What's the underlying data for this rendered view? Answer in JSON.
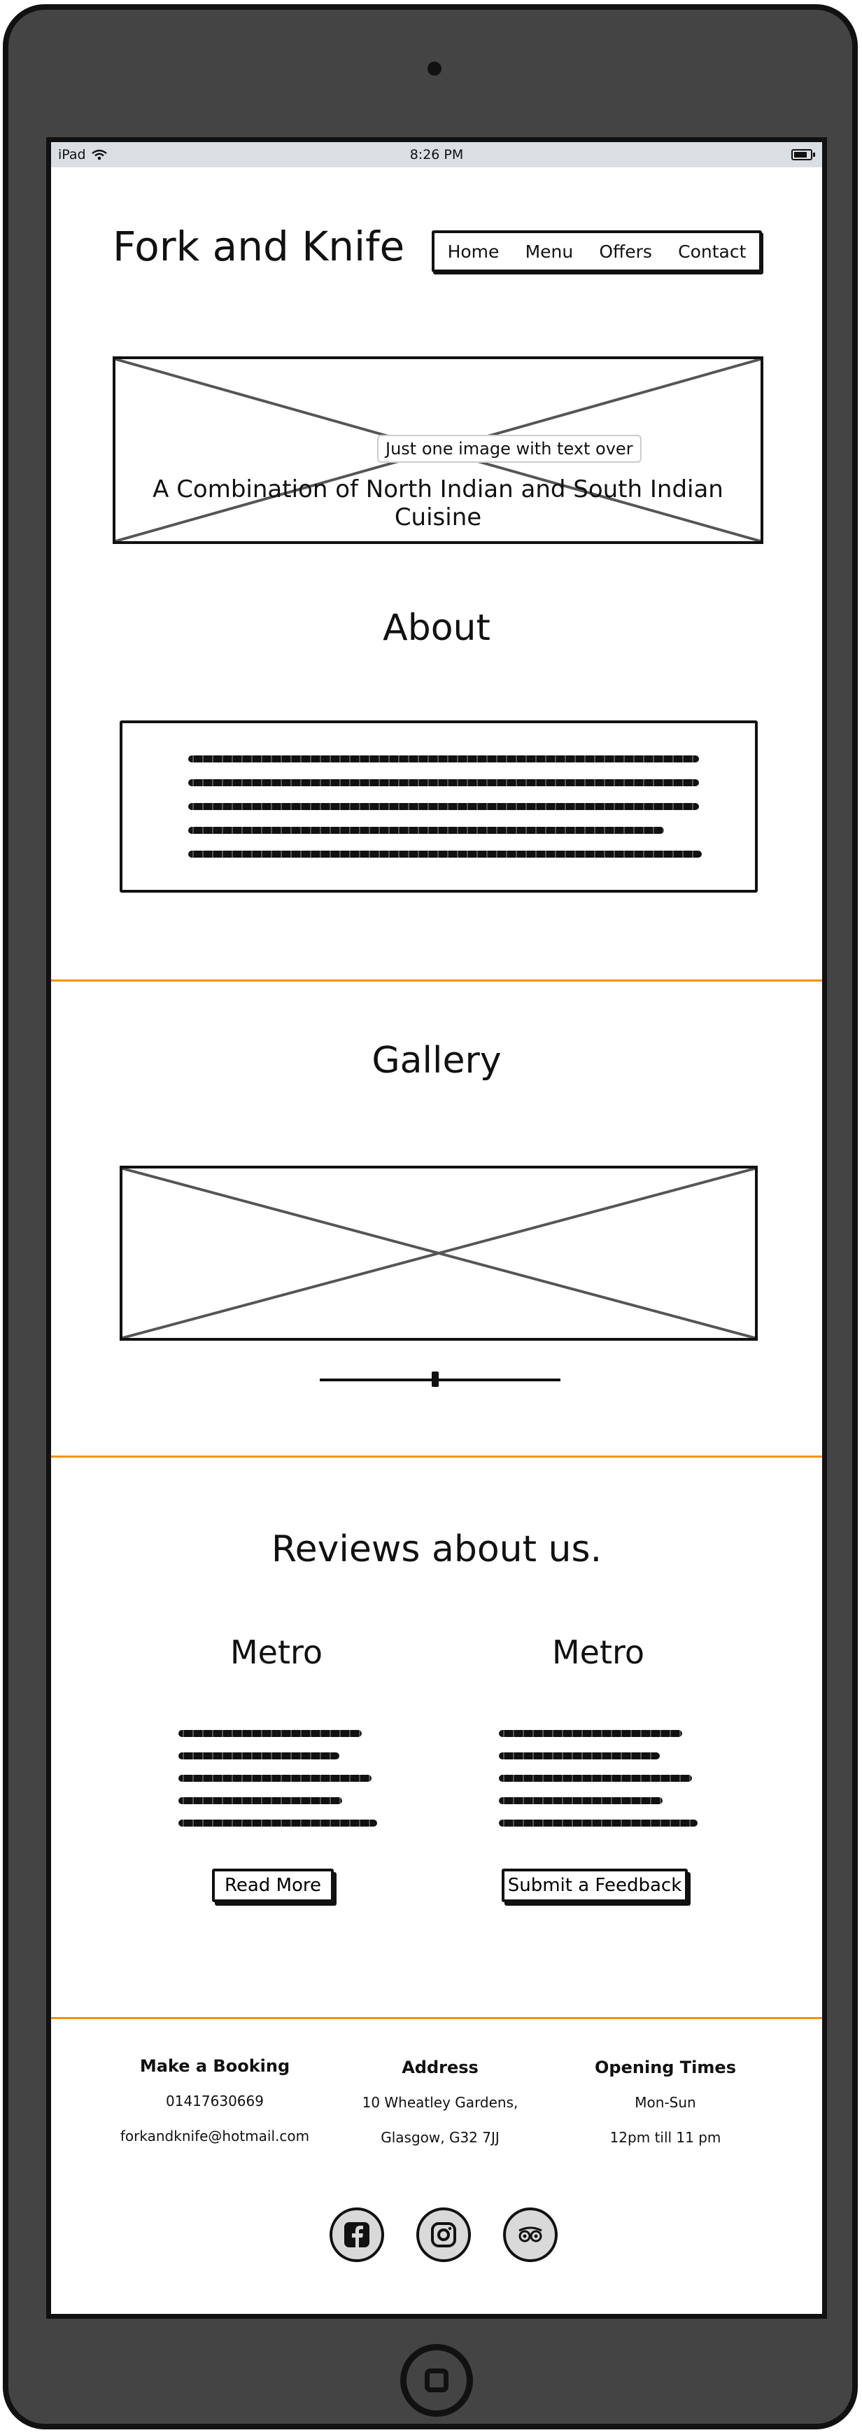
{
  "status_bar": {
    "device": "iPad",
    "time": "8:26 PM"
  },
  "header": {
    "brand": "Fork and Knife",
    "nav": [
      "Home",
      "Menu",
      "Offers",
      "Contact"
    ]
  },
  "hero": {
    "caption": "Just one image with text over",
    "tagline": "A Combination of North Indian and South Indian Cuisine"
  },
  "about": {
    "title": "About"
  },
  "gallery": {
    "title": "Gallery"
  },
  "reviews": {
    "title": "Reviews about us.",
    "cards": [
      {
        "title": "Metro",
        "button": "Read More"
      },
      {
        "title": "Metro",
        "button": "Submit a Feedback"
      }
    ]
  },
  "footer": {
    "booking": {
      "heading": "Make a Booking",
      "phone": "01417630669",
      "email": "forkandknife@hotmail.com"
    },
    "address": {
      "heading": "Address",
      "line1": "10 Wheatley Gardens,",
      "line2": "Glasgow, G32 7JJ"
    },
    "hours": {
      "heading": "Opening Times",
      "days": "Mon-Sun",
      "times": "12pm till 11 pm"
    },
    "social": [
      "facebook-icon",
      "instagram-icon",
      "tripadvisor-icon"
    ]
  },
  "colors": {
    "frame": "#444444",
    "accent": "#f39200",
    "status_bar": "#d9dfe2"
  }
}
